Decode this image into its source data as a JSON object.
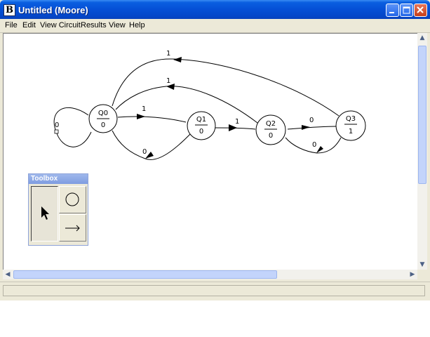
{
  "window": {
    "title": "Untitled (Moore)",
    "app_icon_letter": "B"
  },
  "menu": [
    {
      "label": "File"
    },
    {
      "label": "Edit"
    },
    {
      "label": "View Circuit"
    },
    {
      "label": "Results"
    },
    {
      "label": "View"
    },
    {
      "label": "Help"
    }
  ],
  "diagram": {
    "states": [
      {
        "name": "Q0",
        "output": "0"
      },
      {
        "name": "Q1",
        "output": "0"
      },
      {
        "name": "Q2",
        "output": "0"
      },
      {
        "name": "Q3",
        "output": "1"
      }
    ],
    "transitions": [
      {
        "from": "Q0",
        "to": "Q0",
        "input": "0"
      },
      {
        "from": "Q0",
        "to": "Q1",
        "input": "1"
      },
      {
        "from": "Q1",
        "to": "Q0",
        "input": "0"
      },
      {
        "from": "Q1",
        "to": "Q2",
        "input": "1"
      },
      {
        "from": "Q2",
        "to": "Q0",
        "input": "1"
      },
      {
        "from": "Q2",
        "to": "Q3",
        "input": "0"
      },
      {
        "from": "Q3",
        "to": "Q2",
        "input": "0"
      },
      {
        "from": "Q3",
        "to": "Q0",
        "input": "1"
      }
    ]
  },
  "toolbox": {
    "title": "Toolbox",
    "tools": [
      {
        "name": "select-tool",
        "icon": "arrow-pointer-icon"
      },
      {
        "name": "state-tool",
        "icon": "circle-icon"
      },
      {
        "name": "transition-tool",
        "icon": "right-arrow-icon"
      }
    ]
  },
  "status": {
    "text": ""
  }
}
